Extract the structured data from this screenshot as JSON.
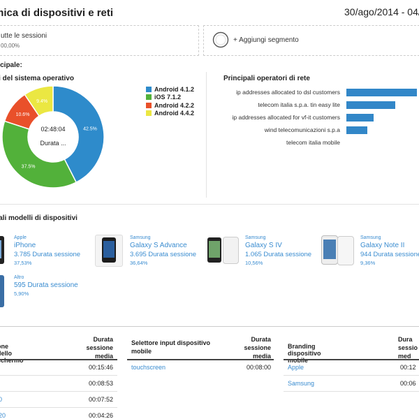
{
  "header": {
    "title": "mica di dispositivi e reti",
    "date_range": "30/ago/2014 - 04/s"
  },
  "segments": {
    "all_sessions": "utte le sessioni",
    "all_sessions_pct": "00,00%",
    "add_segment": "+ Aggiungi segmento"
  },
  "summary_label": "ncipale:",
  "os_chart": {
    "title": "ni del sistema operativo",
    "center_time": "02:48:04",
    "center_label": "Durata ...",
    "legend": [
      {
        "label": "Android 4.1.2",
        "color": "#2e8bcb"
      },
      {
        "label": "iOS 7.1.2",
        "color": "#52b13a"
      },
      {
        "label": "Android 4.2.2",
        "color": "#e9502a"
      },
      {
        "label": "Android 4.4.2",
        "color": "#ebe742"
      }
    ]
  },
  "carriers": {
    "title": "Principali operatori di rete",
    "items": [
      {
        "label": "ip addresses allocated to dsl customers"
      },
      {
        "label": "telecom italia s.p.a. tin easy lite"
      },
      {
        "label": "ip addresses allocated for vf-it customers"
      },
      {
        "label": "wind telecomunicazioni s.p.a"
      },
      {
        "label": "telecom italia mobile"
      }
    ]
  },
  "chart_data": [
    {
      "type": "pie",
      "title": "ni del sistema operativo",
      "categories": [
        "Android 4.1.2",
        "iOS 7.1.2",
        "Android 4.2.2",
        "Android 4.4.2"
      ],
      "values": [
        42.5,
        37.5,
        10.6,
        9.4
      ],
      "value_labels": [
        "42.5%",
        "37.5%",
        "10.6%",
        "9.4%"
      ],
      "colors": [
        "#2e8bcb",
        "#52b13a",
        "#e9502a",
        "#ebe742"
      ],
      "legend": "right"
    },
    {
      "type": "bar",
      "orientation": "horizontal",
      "title": "Principali operatori di rete",
      "categories": [
        "ip addresses allocated to dsl customers",
        "telecom italia s.p.a. tin easy lite",
        "ip addresses allocated for vf-it customers",
        "wind telecomunicazioni s.p.a",
        "telecom italia mobile"
      ],
      "values": [
        100,
        69,
        39,
        30,
        0
      ],
      "color": "#3287c8"
    }
  ],
  "devices": {
    "title": "pali modelli di dispositivi",
    "items": [
      {
        "brand": "Apple",
        "model": "iPhone",
        "duration": "3.785 Durata sessione",
        "pct": "37,53%"
      },
      {
        "brand": "Samsung",
        "model": "Galaxy S Advance",
        "duration": "3.695 Durata sessione",
        "pct": "36,64%"
      },
      {
        "brand": "Samsung",
        "model": "Galaxy S IV",
        "duration": "1.065 Durata sessione",
        "pct": "10,56%"
      },
      {
        "brand": "Samsung",
        "model": "Galaxy Note II",
        "duration": "944 Durata sessione",
        "pct": "9,36%"
      },
      {
        "brand": "Altro",
        "model": "",
        "duration": "595 Durata sessione",
        "pct": "5,90%"
      }
    ]
  },
  "tables": {
    "screen": {
      "header": "one dello schermo",
      "value_header": "Durata sessione media",
      "rows": [
        {
          "label": "",
          "value": "00:15:46"
        },
        {
          "label": "",
          "value": "00:08:53"
        },
        {
          "label": "0",
          "value": "00:07:52"
        },
        {
          "label": "20",
          "value": "00:04:26"
        }
      ]
    },
    "input": {
      "header": "Selettore input dispositivo mobile",
      "value_header": "Durata sessione media",
      "rows": [
        {
          "label": "touchscreen",
          "value": "00:08:00"
        }
      ]
    },
    "branding": {
      "header": "Branding dispositivo mobile",
      "value_header": "Dura sessio med",
      "rows": [
        {
          "label": "Apple",
          "value": "00:12"
        },
        {
          "label": "Samsung",
          "value": "00:06"
        }
      ]
    }
  }
}
